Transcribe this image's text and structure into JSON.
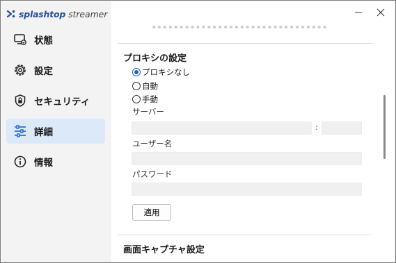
{
  "app": {
    "brand_name": "splashtop",
    "brand_sub": "streamer",
    "brand_color": "#2a4f99"
  },
  "window": {
    "minimize_icon": "minimize-icon",
    "close_icon": "close-icon"
  },
  "sidebar": {
    "items": [
      {
        "label": "状態",
        "icon": "monitor-status-icon",
        "active": false
      },
      {
        "label": "設定",
        "icon": "gear-icon",
        "active": false
      },
      {
        "label": "セキュリティ",
        "icon": "shield-lock-icon",
        "active": false
      },
      {
        "label": "詳細",
        "icon": "sliders-icon",
        "active": true
      },
      {
        "label": "情報",
        "icon": "info-icon",
        "active": false
      }
    ],
    "active_color": "#dce9f9"
  },
  "proxy": {
    "title": "プロキシの設定",
    "options": [
      {
        "label": "プロキシなし",
        "checked": true
      },
      {
        "label": "自動",
        "checked": false
      },
      {
        "label": "手動",
        "checked": false
      }
    ],
    "server_label": "サーバー",
    "server_value": "",
    "port_separator": ":",
    "port_value": "",
    "username_label": "ユーザー名",
    "username_value": "",
    "password_label": "パスワード",
    "password_value": "",
    "apply_label": "適用",
    "accent_color": "#1f63c6"
  },
  "capture": {
    "title": "画面キャプチャ設定"
  }
}
